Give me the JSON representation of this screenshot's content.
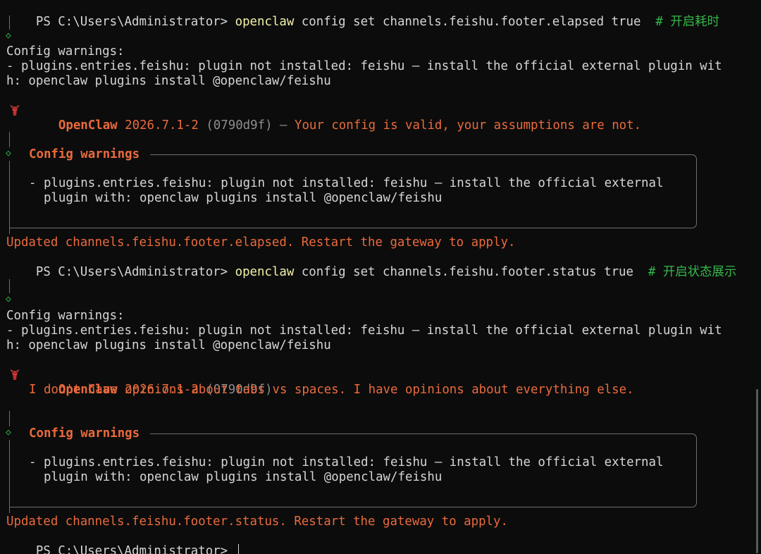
{
  "terminal": {
    "prompt": "PS C:\\Users\\Administrator> ",
    "block1": {
      "cmd_name": "openclaw",
      "cmd_args": " config set channels.feishu.footer.elapsed true  ",
      "cmd_comment": "# 开启耗时",
      "warn_header": "Config warnings:",
      "warn_line1": "- plugins.entries.feishu: plugin not installed: feishu — install the official external plugin wit",
      "warn_line2": "h: openclaw plugins install @openclaw/feishu",
      "banner_name": "OpenClaw",
      "banner_version": "2026.7.1-2",
      "banner_hash": "(0790d9f)",
      "banner_sep": " — ",
      "banner_tagline": "Your config is valid, your assumptions are not.",
      "box_title": "Config warnings",
      "box_line1": "- plugins.entries.feishu: plugin not installed: feishu — install the official external",
      "box_line2": "  plugin with: openclaw plugins install @openclaw/feishu",
      "updated": "Updated channels.feishu.footer.elapsed. Restart the gateway to apply."
    },
    "block2": {
      "cmd_name": "openclaw",
      "cmd_args": " config set channels.feishu.footer.status true  ",
      "cmd_comment": "# 开启状态展示",
      "warn_header": "Config warnings:",
      "warn_line1": "- plugins.entries.feishu: plugin not installed: feishu — install the official external plugin wit",
      "warn_line2": "h: openclaw plugins install @openclaw/feishu",
      "banner_name": "OpenClaw",
      "banner_version": "2026.7.1-2",
      "banner_hash": "(0790d9f)",
      "banner_tagline": "I don't have opinions about tabs vs spaces. I have opinions about everything else.",
      "box_title": "Config warnings",
      "box_line1": "- plugins.entries.feishu: plugin not installed: feishu — install the official external",
      "box_line2": "  plugin with: openclaw plugins install @openclaw/feishu",
      "updated": "Updated channels.feishu.footer.status. Restart the gateway to apply."
    },
    "diamond_glyph": "◇",
    "colors": {
      "background": "#0c0c0c",
      "text": "#d6d6d6",
      "command": "#f1f1a8",
      "comment": "#35b84b",
      "accent": "#ea6a3c",
      "border": "#6f6f6f"
    }
  }
}
